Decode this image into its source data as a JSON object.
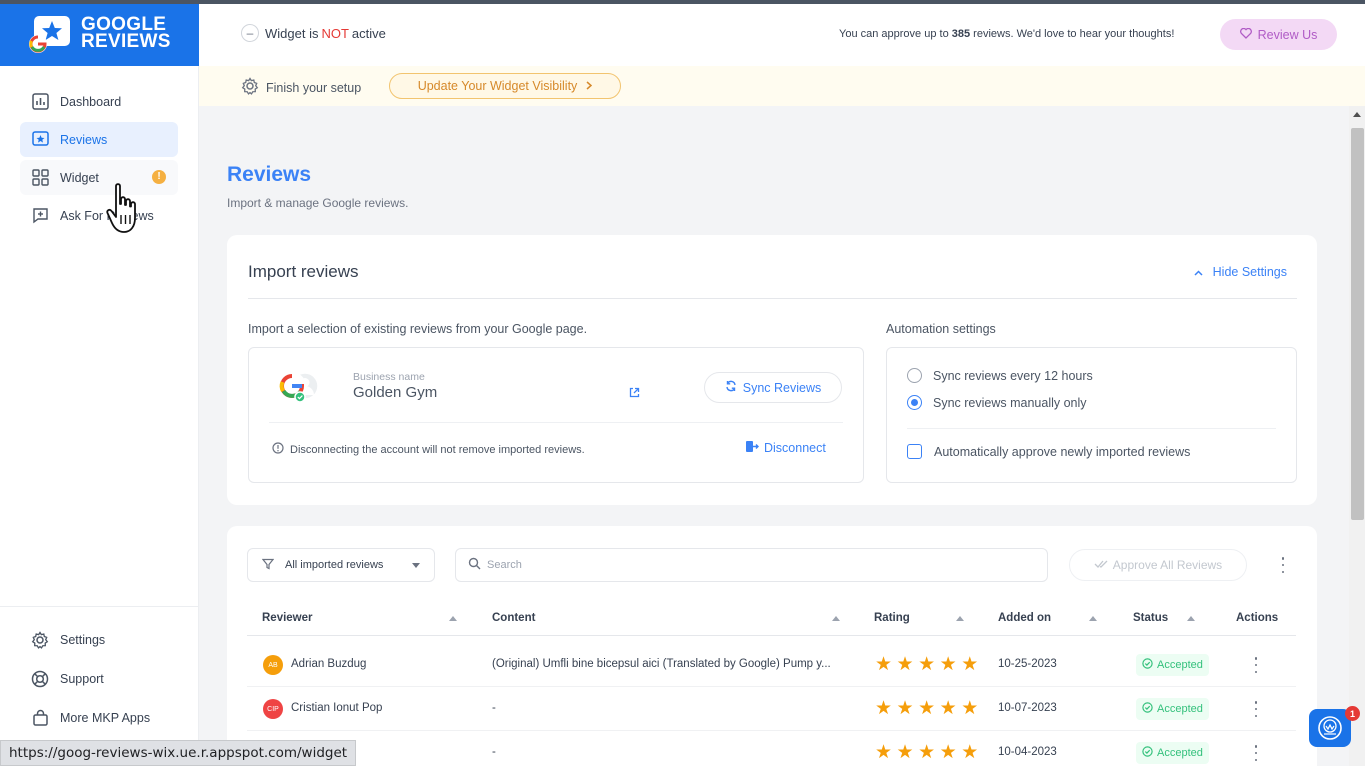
{
  "app": {
    "brand_line1": "GOOGLE",
    "brand_line2": "REVIEWS",
    "accent": "#1a73e8"
  },
  "sidebar": {
    "items": [
      {
        "label": "Dashboard",
        "icon": "bar-chart-icon"
      },
      {
        "label": "Reviews",
        "icon": "star-box-icon",
        "active": true
      },
      {
        "label": "Widget",
        "icon": "grid-icon",
        "badge": "!"
      },
      {
        "label": "Ask For Reviews",
        "icon": "chat-plus-icon"
      }
    ],
    "bottom_items": [
      {
        "label": "Settings",
        "icon": "gear-icon"
      },
      {
        "label": "Support",
        "icon": "lifebuoy-icon"
      },
      {
        "label": "More MKP Apps",
        "icon": "bag-icon"
      }
    ]
  },
  "header": {
    "widget_prefix": "Widget is",
    "widget_not": "NOT",
    "widget_suffix": "active",
    "approve_prefix": "You can approve up to",
    "approve_count": "385",
    "approve_suffix": "reviews. We'd love to hear your thoughts!",
    "review_us": "Review Us"
  },
  "setup": {
    "finish_label": "Finish your setup",
    "visibility_button": "Update Your Widget Visibility"
  },
  "page": {
    "title": "Reviews",
    "subtitle": "Import & manage Google reviews."
  },
  "import": {
    "title": "Import reviews",
    "hide_settings": "Hide Settings",
    "import_label": "Import a selection of existing reviews from your Google page.",
    "business_label": "Business name",
    "business_name": "Golden Gym",
    "sync_button": "Sync Reviews",
    "disconnect_note": "Disconnecting the account will not remove imported reviews.",
    "disconnect_button": "Disconnect"
  },
  "automation": {
    "title": "Automation settings",
    "options": [
      {
        "label": "Sync reviews every 12 hours",
        "selected": false
      },
      {
        "label": "Sync reviews manually only",
        "selected": true
      }
    ],
    "auto_approve": "Automatically approve newly imported reviews"
  },
  "table": {
    "filter": "All imported reviews",
    "search_placeholder": "Search",
    "approve_all": "Approve All Reviews",
    "columns": [
      "Reviewer",
      "Content",
      "Rating",
      "Added on",
      "Status",
      "Actions"
    ],
    "rows": [
      {
        "initials": "AB",
        "avatar_color": "#f59e0b",
        "name": "Adrian Buzdug",
        "content": "(Original) Umfli bine bicepsul aici (Translated by Google) Pump y...",
        "rating": 5,
        "date": "10-25-2023",
        "status": "Accepted"
      },
      {
        "initials": "CIP",
        "avatar_color": "#ef4444",
        "name": "Cristian Ionut Pop",
        "content": "-",
        "rating": 5,
        "date": "10-07-2023",
        "status": "Accepted"
      },
      {
        "initials": "",
        "avatar_color": "#f59e0b",
        "name": "",
        "content": "-",
        "rating": 5,
        "date": "10-04-2023",
        "status": "Accepted"
      }
    ]
  },
  "browser": {
    "status_url": "https://goog-reviews-wix.ue.r.appspot.com/widget"
  },
  "chat": {
    "badge": "1"
  }
}
